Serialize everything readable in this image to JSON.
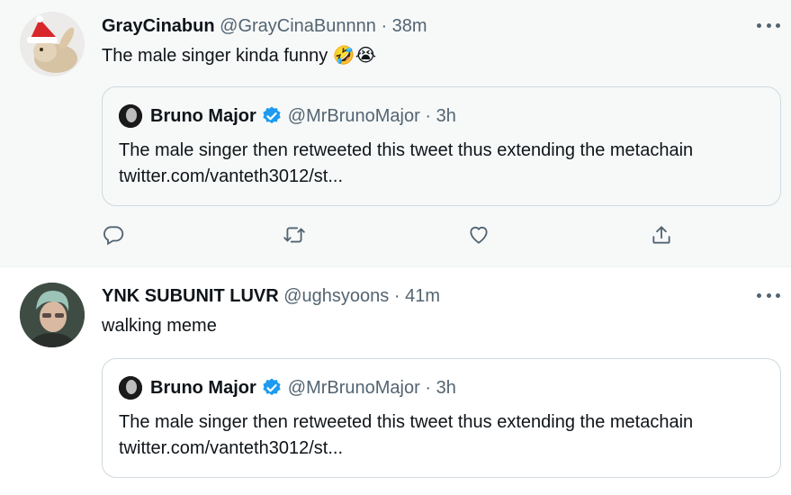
{
  "tweets": [
    {
      "display_name": "GrayCinabun",
      "handle": "@GrayCinaBunnnn",
      "separator": "·",
      "time": "38m",
      "text": "The male singer kinda funny 🤣😭",
      "avatar_icon": "bunny-santa-hat-avatar",
      "quote": {
        "display_name": "Bruno Major",
        "handle": "@MrBrunoMajor",
        "separator": "·",
        "time": "3h",
        "text": "The male singer then retweeted this tweet thus extending the metachain twitter.com/vanteth3012/st..."
      }
    },
    {
      "display_name": "YNK SUBUNIT LUVR",
      "handle": "@ughsyoons",
      "separator": "·",
      "time": "41m",
      "text": "walking meme",
      "avatar_icon": "person-photo-avatar",
      "quote": {
        "display_name": "Bruno Major",
        "handle": "@MrBrunoMajor",
        "separator": "·",
        "time": "3h",
        "text": "The male singer then retweeted this tweet thus extending the metachain twitter.com/vanteth3012/st..."
      }
    }
  ],
  "actions": [
    "reply-icon",
    "retweet-icon",
    "like-icon",
    "share-icon"
  ],
  "colors": {
    "text": "#0f1419",
    "secondary": "#536471",
    "verified": "#1d9bf0",
    "border": "#cfd9de",
    "hover_bg": "#f7f9f9"
  }
}
